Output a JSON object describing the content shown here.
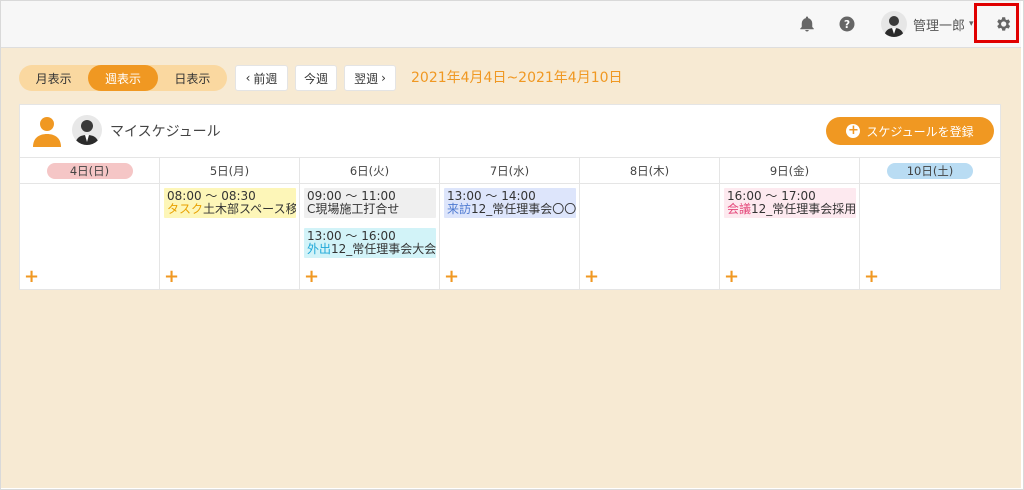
{
  "header": {
    "user_name": "管理一郎",
    "caret": "▾",
    "icons": [
      "bell-icon",
      "help-icon",
      "gear-icon"
    ]
  },
  "toolbar": {
    "view_tabs": [
      {
        "label": "月表示",
        "active": false
      },
      {
        "label": "週表示",
        "active": true
      },
      {
        "label": "日表示",
        "active": false
      }
    ],
    "prev_week": "前週",
    "this_week": "今週",
    "next_week": "翌週",
    "date_range": "2021年4月4日~2021年4月10日"
  },
  "panel": {
    "title": "マイスケジュール",
    "register_button": "スケジュールを登録",
    "days": [
      {
        "label": "4日(日)",
        "events": []
      },
      {
        "label": "5日(月)",
        "events": [
          {
            "time": "08:00 ～ 08:30",
            "category": "タスク",
            "title": "土木部スペース移"
          }
        ]
      },
      {
        "label": "6日(火)",
        "events": [
          {
            "time": "09:00 ～ 11:00",
            "category": "",
            "title": "C現場施工打合せ"
          },
          {
            "time": "13:00 ～ 16:00",
            "category": "外出",
            "title": "12_常任理事会大会"
          }
        ]
      },
      {
        "label": "7日(水)",
        "events": [
          {
            "time": "13:00 ～ 14:00",
            "category": "来訪",
            "title": "12_常任理事会〇〇"
          }
        ]
      },
      {
        "label": "8日(木)",
        "events": []
      },
      {
        "label": "9日(金)",
        "events": [
          {
            "time": "16:00 ～ 17:00",
            "category": "会議",
            "title": "12_常任理事会採用"
          }
        ]
      },
      {
        "label": "10日(土)",
        "events": []
      }
    ],
    "add_symbol": "+"
  },
  "colors": {
    "accent": "#f09822",
    "tab_track": "#fad8a0",
    "main_bg": "#f7ead3",
    "sunday": "#f5c6c6",
    "saturday": "#b9dcf3",
    "event_task": "#fdf6b8",
    "event_plain": "#efefef",
    "event_out": "#d2f3f8",
    "event_visit": "#dde5fb",
    "event_meet": "#fde9ef",
    "highlight": "#e00000"
  }
}
